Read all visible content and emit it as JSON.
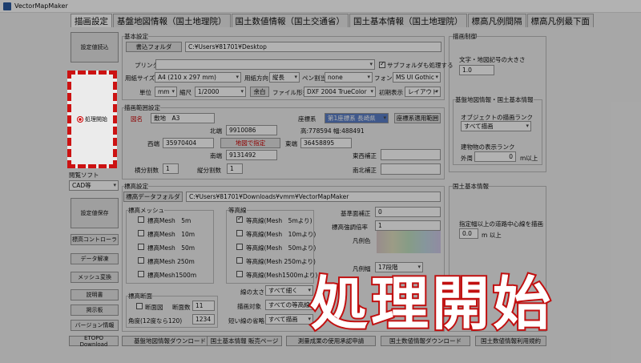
{
  "window": {
    "title": "VectorMapMaker"
  },
  "tabs": [
    "描画設定",
    "基盤地図情報（国土地理院）",
    "国土数値情報（国土交通省）",
    "国土基本情報（国土地理院）",
    "標高凡例間隔",
    "標高凡例最下面"
  ],
  "left": {
    "load_settings": "設定値読込",
    "start_process": "処理開始",
    "viewer_label": "閲覧ソフト",
    "viewer_value": "CAD等",
    "save_settings": "設定値保存",
    "elev_control": "標高コントローラ",
    "data_unzip": "データ解凍",
    "mesh_convert": "メッシュ変換",
    "manual": "説明書",
    "board": "掲示板",
    "version": "バージョン情報",
    "etopo": "ETOPO Download"
  },
  "basic": {
    "title": "基本設定",
    "folder_btn": "書込フォルダ",
    "folder_path": "C:¥Users¥81701¥Desktop",
    "printer_label": "プリンタ",
    "subfolder_label": "サブフォルダも処理する",
    "paper_label": "用紙サイズ",
    "paper_value": "A4 (210 x 297 mm)",
    "orient_label": "用紙方向",
    "orient_value": "縦長",
    "pen_label": "ペン割当",
    "pen_value": "none",
    "font_label": "フォント",
    "font_value": "MS UI Gothic",
    "unit_label": "単位",
    "unit_value": "mm",
    "scale_label": "縮尺",
    "scale_value": "1/2000",
    "margin_btn": "余白",
    "format_label": "ファイル形式",
    "format_value": "DXF 2004 TrueColor",
    "initial_label": "初期表示",
    "initial_value": "レイアウト"
  },
  "range": {
    "title": "描画範囲設定",
    "name_label": "図名",
    "name_value": "敷地　A3",
    "coord_label": "座標系",
    "coord_value": "第1座標系 長崎県",
    "coord_btn": "座標系適用範囲",
    "north_label": "北端",
    "north_value": "9910086",
    "hw_text": "高:778594 幅:488491",
    "west_label": "西端",
    "west_value": "35970404",
    "map_btn": "地図で指定",
    "east_label": "東端",
    "east_value": "36458895",
    "south_label": "南端",
    "south_value": "9131492",
    "ew_corr_label": "東西補正",
    "ns_corr_label": "南北補正",
    "hsplit_label": "横分割数",
    "hsplit_value": "1",
    "vsplit_label": "縦分割数",
    "vsplit_value": "1"
  },
  "elevation": {
    "title": "標高設定",
    "folder_btn": "標高データフォルダ",
    "folder_path": "C:¥Users¥81701¥Downloads¥vmm¥VectorMapMaker",
    "mesh_title": "標高メッシュ",
    "mesh_items": [
      "標高Mesh　5m",
      "標高Mesh　10m",
      "標高Mesh　50m",
      "標高Mesh 250m",
      "標高Mesh1500m"
    ],
    "contour_title": "等高線",
    "contour_items": [
      "等高線(Mesh　5mより)",
      "等高線(Mesh　10mより)",
      "等高線(Mesh　50mより)",
      "等高線(Mesh 250mより)",
      "等高線(Mesh1500mより)"
    ],
    "base_corr_label": "基準面補正",
    "base_corr_value": "0",
    "scale_label": "標高強調倍率",
    "scale_value": "1",
    "legend_label": "凡例色",
    "legend_interval_label": "凡例幅",
    "legend_interval_value": "17段階",
    "line_width_label": "線の太さ",
    "line_width_value": "すべて細く",
    "target_label": "描画対象",
    "target_value": "すべての等高線",
    "short_label": "短い線の省略",
    "short_value": "すべて描画",
    "section_title": "標高断面",
    "section_label": "断面図",
    "section_count_label": "断面数",
    "section_count_value": "11",
    "angle_label": "角度(12度なら120)",
    "angle_value": "1234"
  },
  "draw_ctrl": {
    "title": "描画制御",
    "char_size_label": "文字・地図記号の大きさ",
    "char_size_value": "1.0",
    "kiban_title": "基盤地図情報・国土基本情報",
    "rank_label": "オブジェクトの描画ランク",
    "rank_value": "すべて描画",
    "building_label": "建物物の表示ランク",
    "outer_label": "外周",
    "outer_value": "0",
    "outer_unit": "m以上"
  },
  "kokudo": {
    "title": "国土基本情報",
    "road_label": "指定幅以上の道路中心線を描画",
    "road_value": "0.0",
    "road_unit": "m 以上"
  },
  "bottom": {
    "kiban_dl": "基盤地図情報ダウンロード",
    "kihon_shop": "国土基本情報 販売ページ",
    "survey": "測量成果の使用承認申請",
    "suuchi_dl": "国土数値情報ダウンロード",
    "suuchi_list": "国土数値情報利用規約"
  },
  "overlay_text": "処理開始"
}
